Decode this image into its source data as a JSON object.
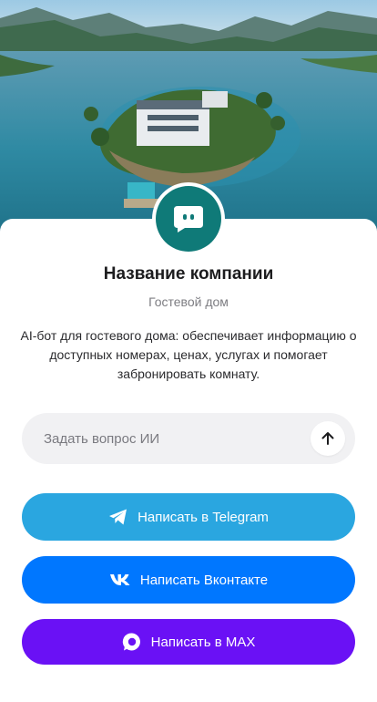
{
  "hero": {
    "image": "lake-island-guest-house-photo"
  },
  "company": {
    "name": "Название компании",
    "type": "Гостевой дом",
    "description": "AI-бот для гостевого дома: обеспечивает информацию о доступных номерах, ценах, услугах и помогает забронировать комнату."
  },
  "ask": {
    "placeholder": "Задать вопрос ИИ",
    "value": ""
  },
  "buttons": {
    "telegram": {
      "label": "Написать в Telegram",
      "icon": "telegram-icon",
      "color": "#2aa6e0"
    },
    "vk": {
      "label": "Написать Вконтакте",
      "icon": "vk-icon",
      "color": "#0077ff"
    },
    "max": {
      "label": "Написать в MAX",
      "icon": "max-icon",
      "color": "#6a11f5"
    }
  },
  "colors": {
    "accent": "#0f7a78"
  }
}
